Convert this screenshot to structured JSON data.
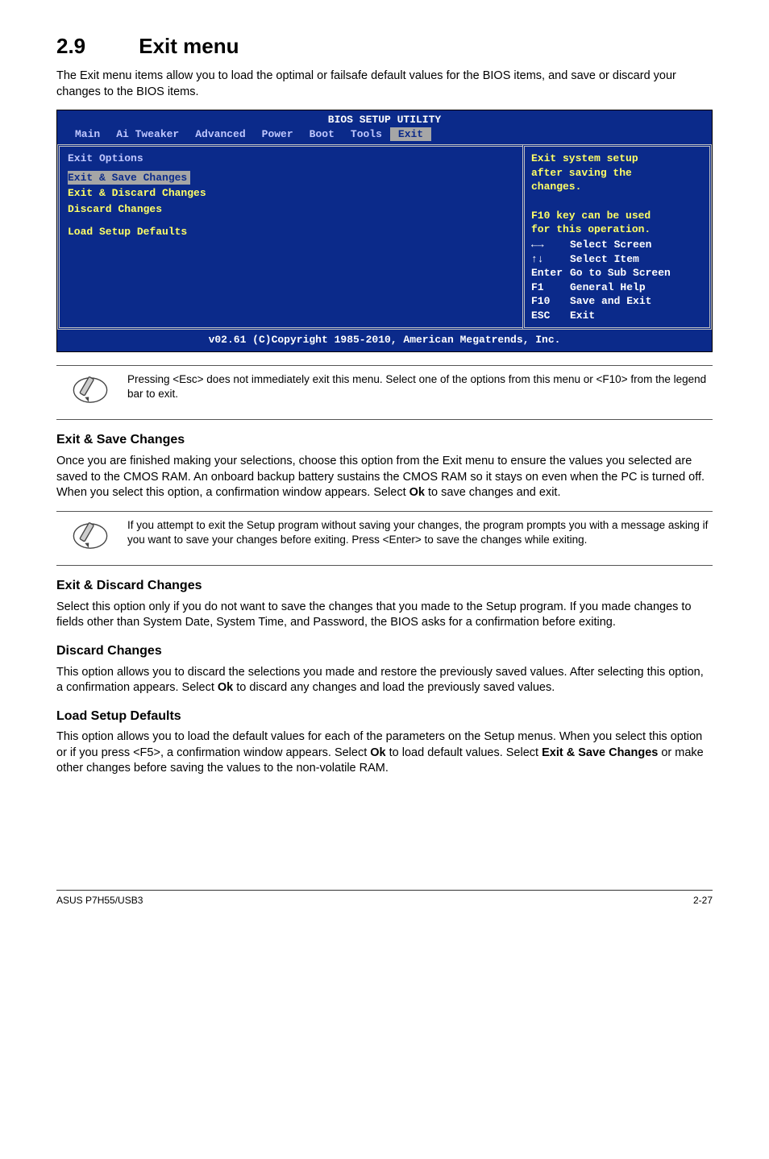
{
  "heading": {
    "number": "2.9",
    "title": "Exit menu"
  },
  "intro": "The Exit menu items allow you to load the optimal or failsafe default values for the BIOS items, and save or discard your changes to the BIOS items.",
  "bios": {
    "header_title": "BIOS SETUP UTILITY",
    "menu": {
      "main": "Main",
      "ai_tweaker": "Ai Tweaker",
      "advanced": "Advanced",
      "power": "Power",
      "boot": "Boot",
      "tools": "Tools",
      "exit": "Exit"
    },
    "left": {
      "title": "Exit Options",
      "items": [
        "Exit & Save Changes",
        "Exit & Discard Changes",
        "Discard Changes",
        "Load Setup Defaults"
      ]
    },
    "right_top": [
      "Exit system setup",
      "after saving the",
      "changes.",
      "",
      "F10 key can be used",
      "for this operation."
    ],
    "right_bottom": [
      {
        "key": "←→",
        "label": "Select Screen"
      },
      {
        "key": "↑↓",
        "label": "Select Item"
      },
      {
        "key": "Enter",
        "label": "Go to Sub Screen"
      },
      {
        "key": "F1",
        "label": "General Help"
      },
      {
        "key": "F10",
        "label": "Save and Exit"
      },
      {
        "key": "ESC",
        "label": "Exit"
      }
    ],
    "footer": "v02.61 (C)Copyright 1985-2010, American Megatrends, Inc."
  },
  "note1": "Pressing <Esc> does not immediately exit this menu. Select one of the options from this menu or <F10> from the legend bar to exit.",
  "sec_save": {
    "title": "Exit & Save Changes",
    "text": "Once you are finished making your selections, choose this option from the Exit menu to ensure the values you selected are saved to the CMOS RAM. An onboard backup battery sustains the CMOS RAM so it stays on even when the PC is turned off. When you select this option, a confirmation window appears. Select Ok to save changes and exit.",
    "bold": "Ok"
  },
  "note2": "If you attempt to exit the Setup program without saving your changes, the program prompts you with a message asking if you want to save your changes before exiting. Press <Enter> to save the changes while exiting.",
  "sec_discard_exit": {
    "title": "Exit & Discard Changes",
    "text": "Select this option only if you do not want to save the changes that you  made to the Setup program. If you made changes to fields other than System Date, System Time, and Password, the BIOS asks for a confirmation before exiting."
  },
  "sec_discard": {
    "title": "Discard Changes",
    "text_before": "This option allows you to discard the selections you made and restore the previously saved values. After selecting this option, a confirmation appears. Select ",
    "bold": "Ok",
    "text_after": " to discard any changes and load the previously saved values."
  },
  "sec_load": {
    "title": "Load Setup Defaults",
    "text_before": "This option allows you to load the default values for each of the parameters on the Setup menus. When you select this option or if you press <F5>, a confirmation window appears. Select ",
    "bold1": "Ok",
    "text_mid": " to load default values. Select ",
    "bold2": "Exit & Save Changes",
    "text_after": " or make other changes before saving the values to the non-volatile RAM."
  },
  "footer": {
    "left": "ASUS P7H55/USB3",
    "right": "2-27"
  }
}
